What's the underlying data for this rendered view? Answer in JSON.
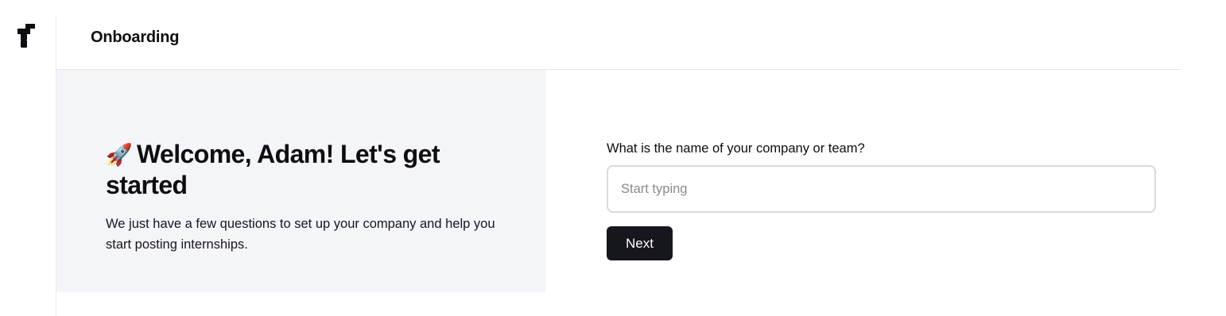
{
  "header": {
    "title": "Onboarding"
  },
  "intro": {
    "emoji": "🚀",
    "heading": "Welcome, Adam! Let's get started",
    "description": "We just have a few questions to set up your company and help you start posting internships."
  },
  "form": {
    "question": "What is the name of your company or team?",
    "input_value": "",
    "input_placeholder": "Start typing",
    "next_label": "Next"
  },
  "icons": {
    "logo": "brand-logo-icon",
    "rocket": "rocket-emoji"
  },
  "colors": {
    "primary_button": "#16161d",
    "panel_background": "#f4f5f9",
    "text": "#0d0d12"
  }
}
